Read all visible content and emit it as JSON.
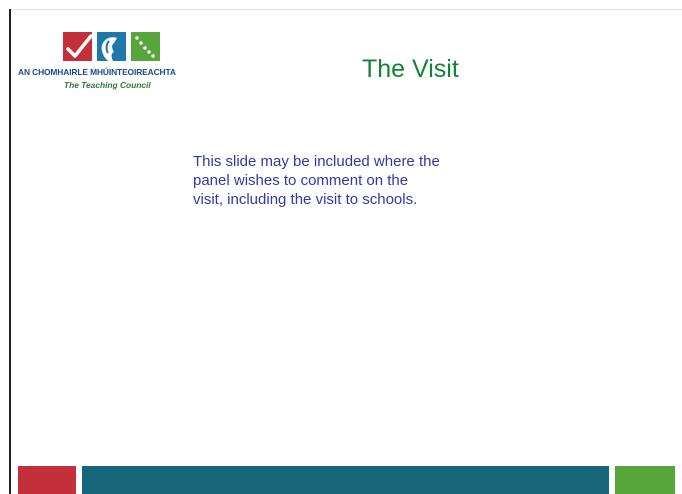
{
  "logo": {
    "name": "AN CHOMHAIRLE MHÚINTEOIREACHTA",
    "tagline": "The Teaching Council",
    "icons": [
      "check-icon",
      "head-profile-icon",
      "dots-icon"
    ]
  },
  "slide": {
    "title": "The Visit",
    "body": "This slide may be included where the\npanel wishes to comment on the\nvisit, including the visit to schools."
  },
  "colors": {
    "title": "#168238",
    "body": "#3039a6",
    "logo_name": "#1c4a8c",
    "logo_tagline": "#2f7b36",
    "footer_red": "#c3303a",
    "footer_teal": "#17667a",
    "footer_green": "#56a63c"
  }
}
